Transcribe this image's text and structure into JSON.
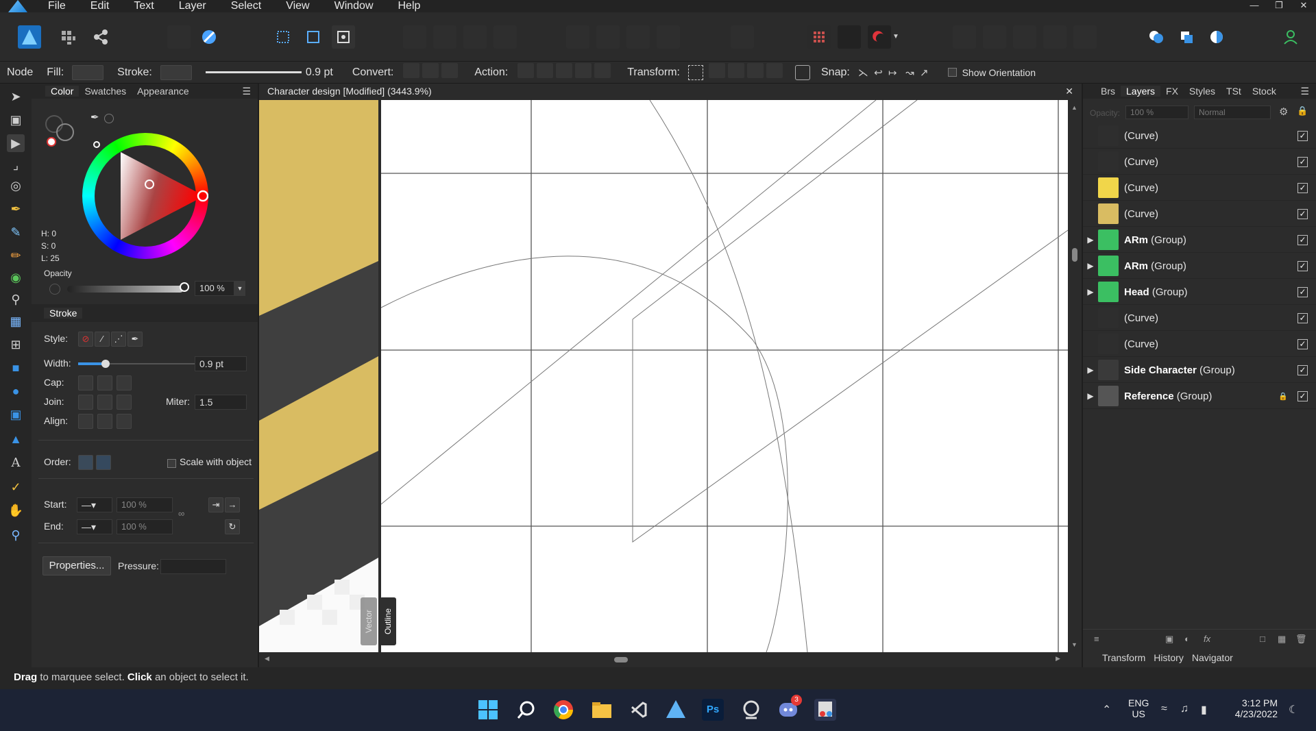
{
  "menubar": {
    "items": [
      "File",
      "Edit",
      "Text",
      "Layer",
      "Select",
      "View",
      "Window",
      "Help"
    ]
  },
  "context": {
    "mode": "Node",
    "fill_label": "Fill:",
    "stroke_label": "Stroke:",
    "stroke_width": "0.9 pt",
    "convert_label": "Convert:",
    "action_label": "Action:",
    "transform_label": "Transform:",
    "snap_label": "Snap:",
    "show_orientation": "Show Orientation"
  },
  "colorpanel": {
    "tabs": [
      "Color",
      "Swatches",
      "Appearance"
    ],
    "h": "H: 0",
    "s": "S: 0",
    "l": "L: 25",
    "opacity_label": "Opacity",
    "opacity_value": "100 %"
  },
  "strokepanel": {
    "tab": "Stroke",
    "style_label": "Style:",
    "width_label": "Width:",
    "width_value": "0.9 pt",
    "cap_label": "Cap:",
    "join_label": "Join:",
    "miter_label": "Miter:",
    "miter_value": "1.5",
    "align_label": "Align:",
    "order_label": "Order:",
    "scale_label": "Scale with object",
    "start_label": "Start:",
    "start_pct": "100 %",
    "end_label": "End:",
    "end_pct": "100 %",
    "properties_btn": "Properties...",
    "pressure_label": "Pressure:"
  },
  "document": {
    "title": "Character design [Modified] (3443.9%)",
    "vector_label": "Vector",
    "outline_label": "Outline"
  },
  "layerspanel": {
    "tabs": [
      "Brs",
      "Layers",
      "FX",
      "Styles",
      "TSt",
      "Stock"
    ],
    "opacity_label": "Opacity:",
    "opacity_value": "100 %",
    "blend_mode": "Normal",
    "layers": [
      {
        "name": "",
        "kind": "(Curve)",
        "group": false
      },
      {
        "name": "",
        "kind": "(Curve)",
        "group": false
      },
      {
        "name": "",
        "kind": "(Curve)",
        "group": false
      },
      {
        "name": "",
        "kind": "(Curve)",
        "group": false
      },
      {
        "name": "ARm",
        "kind": " (Group)",
        "group": true
      },
      {
        "name": "ARm",
        "kind": " (Group)",
        "group": true
      },
      {
        "name": "Head",
        "kind": " (Group)",
        "group": true
      },
      {
        "name": "",
        "kind": "(Curve)",
        "group": false
      },
      {
        "name": "",
        "kind": "(Curve)",
        "group": false
      },
      {
        "name": "Side Character",
        "kind": " (Group)",
        "group": true
      },
      {
        "name": "Reference",
        "kind": " (Group)",
        "group": true
      }
    ],
    "bottom_tabs": [
      "Transform",
      "History",
      "Navigator"
    ]
  },
  "status": {
    "drag": "Drag",
    "drag_text": " to marquee select. ",
    "click": "Click",
    "click_text": " an object to select it."
  },
  "taskbar": {
    "lang1": "ENG",
    "lang2": "US",
    "time": "3:12 PM",
    "date": "4/23/2022",
    "discord_badge": "3"
  },
  "colors": {
    "accent": "#1e8fe0",
    "ochre": "#d9bc62",
    "canvas_bg": "#ffffff"
  }
}
